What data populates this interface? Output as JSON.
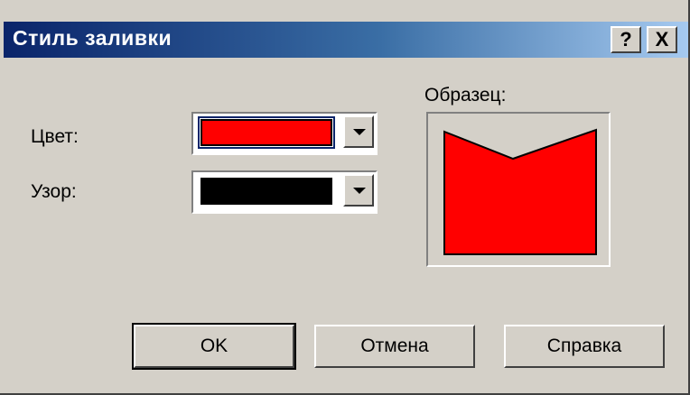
{
  "window": {
    "title": "Стиль заливки",
    "help_glyph": "?",
    "close_glyph": "X"
  },
  "form": {
    "color_label": "Цвет:",
    "color_value": "#ff0000",
    "pattern_label": "Узор:",
    "pattern_value": "#000000",
    "sample_label": "Образец:"
  },
  "preview": {
    "fill_color": "#ff0000"
  },
  "buttons": {
    "ok": "OK",
    "cancel": "Отмена",
    "help": "Справка"
  },
  "icons": [
    "help-icon",
    "close-icon",
    "dropdown-arrow-icon"
  ]
}
